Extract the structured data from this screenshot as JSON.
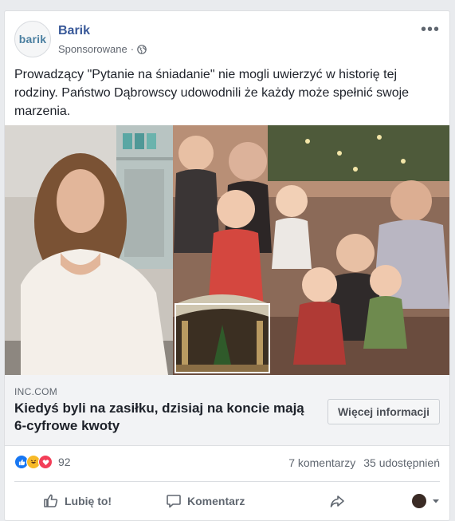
{
  "post": {
    "page_name": "Barik",
    "logo_text": "barik",
    "sponsored_label": "Sponsorowane",
    "separator": "·",
    "more_icon": "•••",
    "text": "Prowadzący \"Pytanie na śniadanie\" nie mogli uwierzyć w historię tej rodziny. Państwo Dąbrowscy udowodnili że każdy może spełnić swoje marzenia."
  },
  "link": {
    "domain": "INC.COM",
    "headline": "Kiedyś byli na zasiłku, dzisiaj na koncie mają 6-cyfrowe kwoty",
    "cta_label": "Więcej informacji"
  },
  "stats": {
    "reaction_count": "92",
    "comments": "7 komentarzy",
    "shares": "35 udostępnień"
  },
  "actions": {
    "like": "Lubię to!",
    "comment": "Komentarz"
  },
  "colors": {
    "brand_link": "#385898",
    "like_blue": "#1877f2",
    "haha_yellow": "#f7b928",
    "love_red": "#f33e58"
  }
}
